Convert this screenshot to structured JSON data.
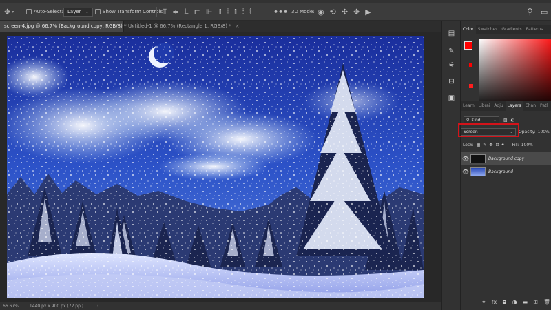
{
  "options_bar": {
    "auto_select_label": "Auto-Select:",
    "layer_dropdown": "Layer",
    "show_transform_label": "Show Transform Controls",
    "mode_3d_label": "3D Mode:"
  },
  "tabs": [
    {
      "label": "screen-4.jpg @ 66.7% (Background copy, RGB/8) *"
    },
    {
      "label": "Untitled-1 @ 66.7% (Rectangle 1, RGB/8) *"
    }
  ],
  "status": {
    "zoom": "66.67%",
    "doc_size": "1440 px x 900 px (72 ppi)"
  },
  "panels": {
    "color_tabs": [
      "Color",
      "Swatches",
      "Gradients",
      "Patterns"
    ],
    "layer_tabs": [
      "Learn",
      "Librai",
      "Adju",
      "Layers",
      "Chan",
      "Patl"
    ],
    "kind_label": "Kind",
    "blend_mode": "Screen",
    "opacity_label": "Opacity:",
    "opacity_value": "100%",
    "lock_label": "Lock:",
    "fill_label": "Fill:",
    "fill_value": "100%",
    "layers": [
      {
        "name": "Background copy"
      },
      {
        "name": "Background"
      }
    ],
    "foreground_color": "#ff0000",
    "accent_highlight": "#d4131a"
  }
}
